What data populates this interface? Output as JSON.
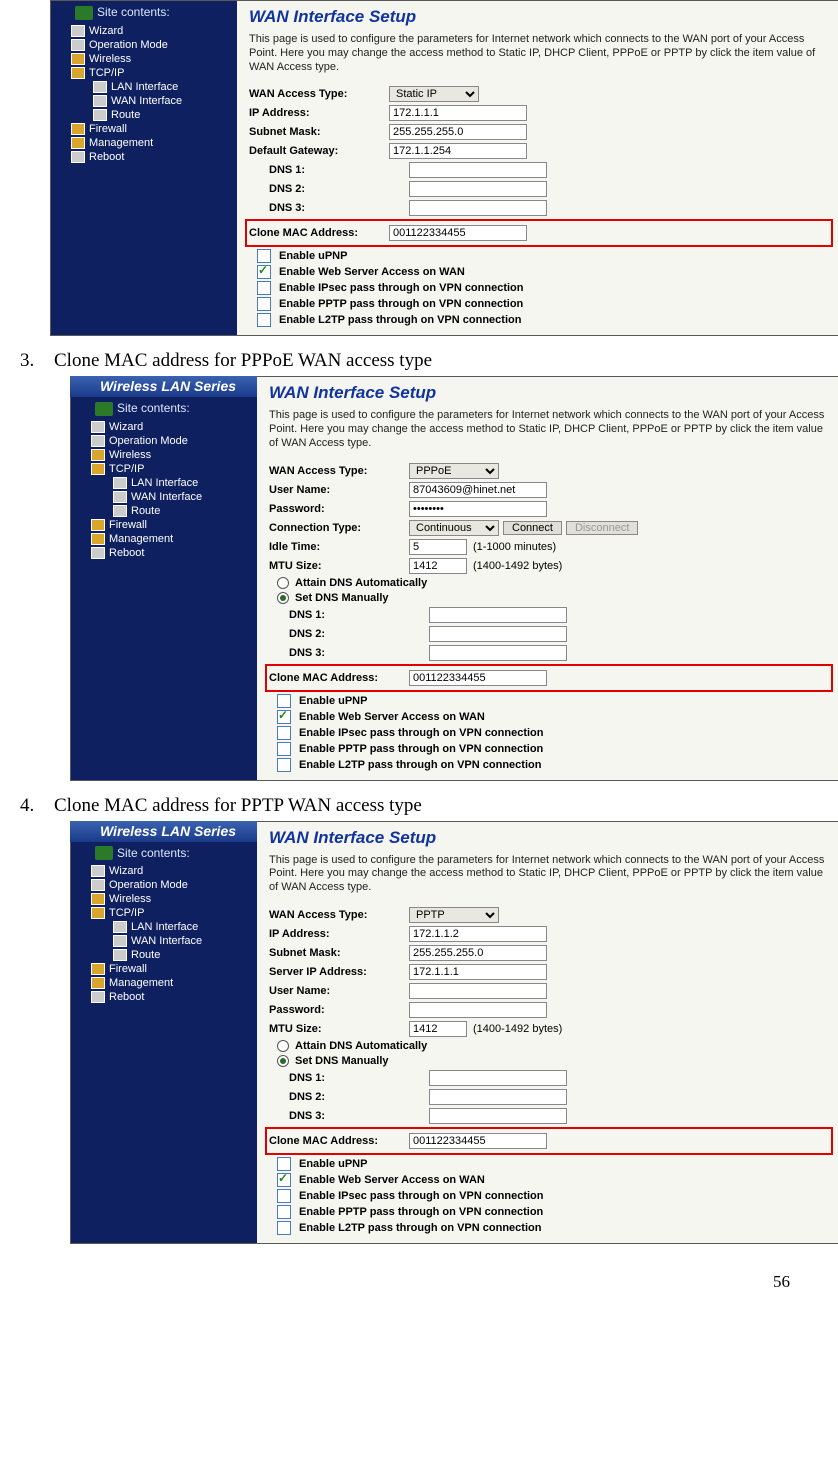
{
  "page_number": "56",
  "steps": {
    "s3": {
      "num": "3.",
      "text": "Clone MAC address for PPPoE WAN access type"
    },
    "s4": {
      "num": "4.",
      "text": "Clone MAC address for PPTP WAN access type"
    }
  },
  "common": {
    "titlebar": "Wireless LAN Series",
    "heading": "WAN Interface Setup",
    "description": "This page is used to configure the parameters for Internet network which connects to the WAN port of your Access Point. Here you may change the access method to Static IP, DHCP Client, PPPoE or PPTP by click the item value of WAN Access type.",
    "sidebar_title": "Site contents:",
    "tree": {
      "wizard": "Wizard",
      "opmode": "Operation Mode",
      "wireless": "Wireless",
      "tcpip": "TCP/IP",
      "lan": "LAN Interface",
      "wan": "WAN Interface",
      "route": "Route",
      "firewall": "Firewall",
      "mgmt": "Management",
      "reboot": "Reboot"
    },
    "labels": {
      "wan_access": "WAN Access Type:",
      "ip": "IP Address:",
      "subnet": "Subnet Mask:",
      "gateway": "Default Gateway:",
      "server_ip": "Server IP Address:",
      "user": "User Name:",
      "pass": "Password:",
      "conn_type": "Connection Type:",
      "idle": "Idle Time:",
      "mtu": "MTU Size:",
      "dns1": "DNS 1:",
      "dns2": "DNS 2:",
      "dns3": "DNS 3:",
      "clone_mac": "Clone MAC Address:",
      "attain_dns": "Attain DNS Automatically",
      "set_dns": "Set DNS Manually",
      "idle_note": "(1-1000 minutes)",
      "mtu_note": "(1400-1492 bytes)",
      "connect": "Connect",
      "disconnect": "Disconnect"
    },
    "checks": {
      "upnp": "Enable uPNP",
      "web": "Enable Web Server Access on WAN",
      "ipsec": "Enable IPsec pass through on VPN connection",
      "pptp": "Enable PPTP pass through on VPN connection",
      "l2tp": "Enable L2TP pass through on VPN connection"
    }
  },
  "shot1": {
    "access": "Static IP",
    "ip": "172.1.1.1",
    "subnet": "255.255.255.0",
    "gateway": "172.1.1.254",
    "dns1": "",
    "dns2": "",
    "dns3": "",
    "clone_mac": "001122334455"
  },
  "shot2": {
    "access": "PPPoE",
    "user": "87043609@hinet.net",
    "pass": "••••••••",
    "conn_type": "Continuous",
    "idle": "5",
    "mtu": "1412",
    "dns1": "",
    "dns2": "",
    "dns3": "",
    "clone_mac": "001122334455"
  },
  "shot3": {
    "access": "PPTP",
    "ip": "172.1.1.2",
    "subnet": "255.255.255.0",
    "server_ip": "172.1.1.1",
    "user": "",
    "pass": "",
    "mtu": "1412",
    "dns1": "",
    "dns2": "",
    "dns3": "",
    "clone_mac": "001122334455"
  }
}
